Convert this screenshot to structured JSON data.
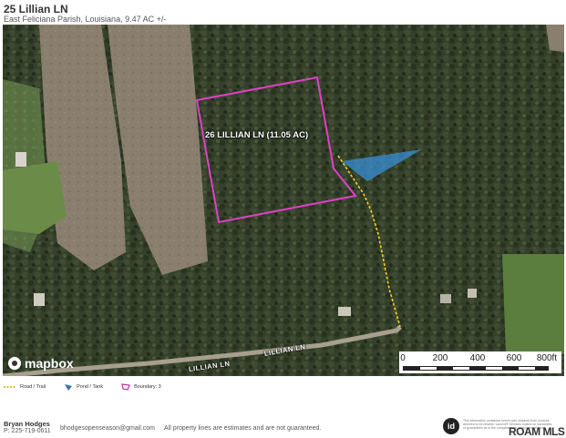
{
  "header": {
    "title": "25 Lillian LN",
    "subtitle": "East Feliciana Parish, Louisiana, 9.47 AC +/-"
  },
  "map": {
    "parcel_label": "26 LILLIAN LN (11.05 AC)",
    "road_labels": [
      "LILLIAN LN",
      "LILLIAN LN"
    ],
    "attribution": "mapbox",
    "scale_labels": [
      "0",
      "200",
      "400",
      "600",
      "800ft"
    ],
    "colors": {
      "boundary": "#e040c8",
      "road_trail": "#f5d020",
      "pond": "#3a8fd6"
    }
  },
  "legend": [
    {
      "label": "Road / Trail",
      "icon": "dashed-line-icon"
    },
    {
      "label": "Pond / Tank",
      "icon": "pond-icon"
    },
    {
      "label": "Boundary: 3",
      "icon": "boundary-icon"
    }
  ],
  "footer": {
    "agent_name": "Bryan Hodges",
    "phone": "P: 225-719-0611",
    "email": "bhodgesopenseason@gmail.com",
    "disclaimer": "All property lines are estimates and are not guaranteed.",
    "id_logo": "id",
    "fine_print": "This information contained herein was obtained from sources deemed to be reliable. Land id® Services makes no warranties or guarantees as to the completeness or accuracy thereof.",
    "brand": "ROAM MLS"
  }
}
